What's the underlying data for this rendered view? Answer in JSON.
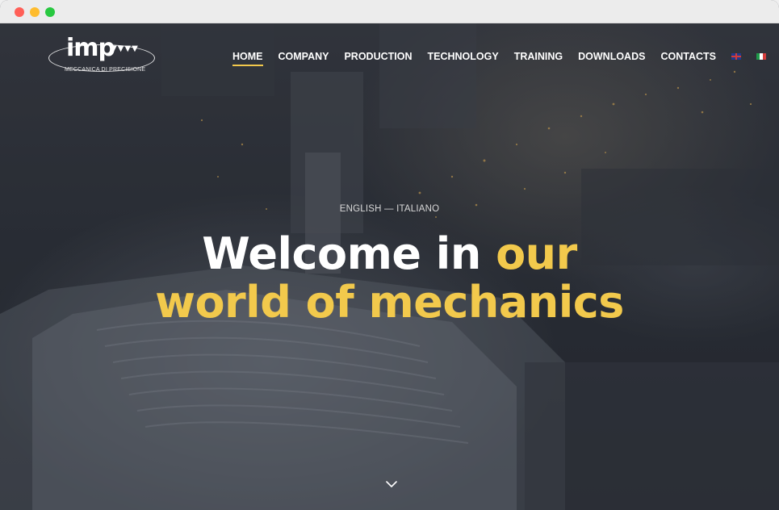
{
  "logo": {
    "mark": "imp",
    "arrows": "▼▼▼▼",
    "tagline": "MECCANICA DI PRECISIONE"
  },
  "nav": {
    "items": [
      {
        "label": "HOME",
        "active": true
      },
      {
        "label": "COMPANY"
      },
      {
        "label": "PRODUCTION"
      },
      {
        "label": "TECHNOLOGY"
      },
      {
        "label": "TRAINING"
      },
      {
        "label": "DOWNLOADS"
      },
      {
        "label": "CONTACTS"
      }
    ],
    "flags": [
      "flag-uk-icon",
      "flag-italy-icon"
    ]
  },
  "hero": {
    "lang_switch": "ENGLISH — ITALIANO",
    "headline_white": "Welcome in ",
    "headline_yellow_1": "our",
    "headline_yellow_2": "world of mechanics",
    "scroll_icon": "chevron-down-icon"
  },
  "colors": {
    "accent": "#f2c94c",
    "text": "#ffffff",
    "background": "#2f333b"
  }
}
